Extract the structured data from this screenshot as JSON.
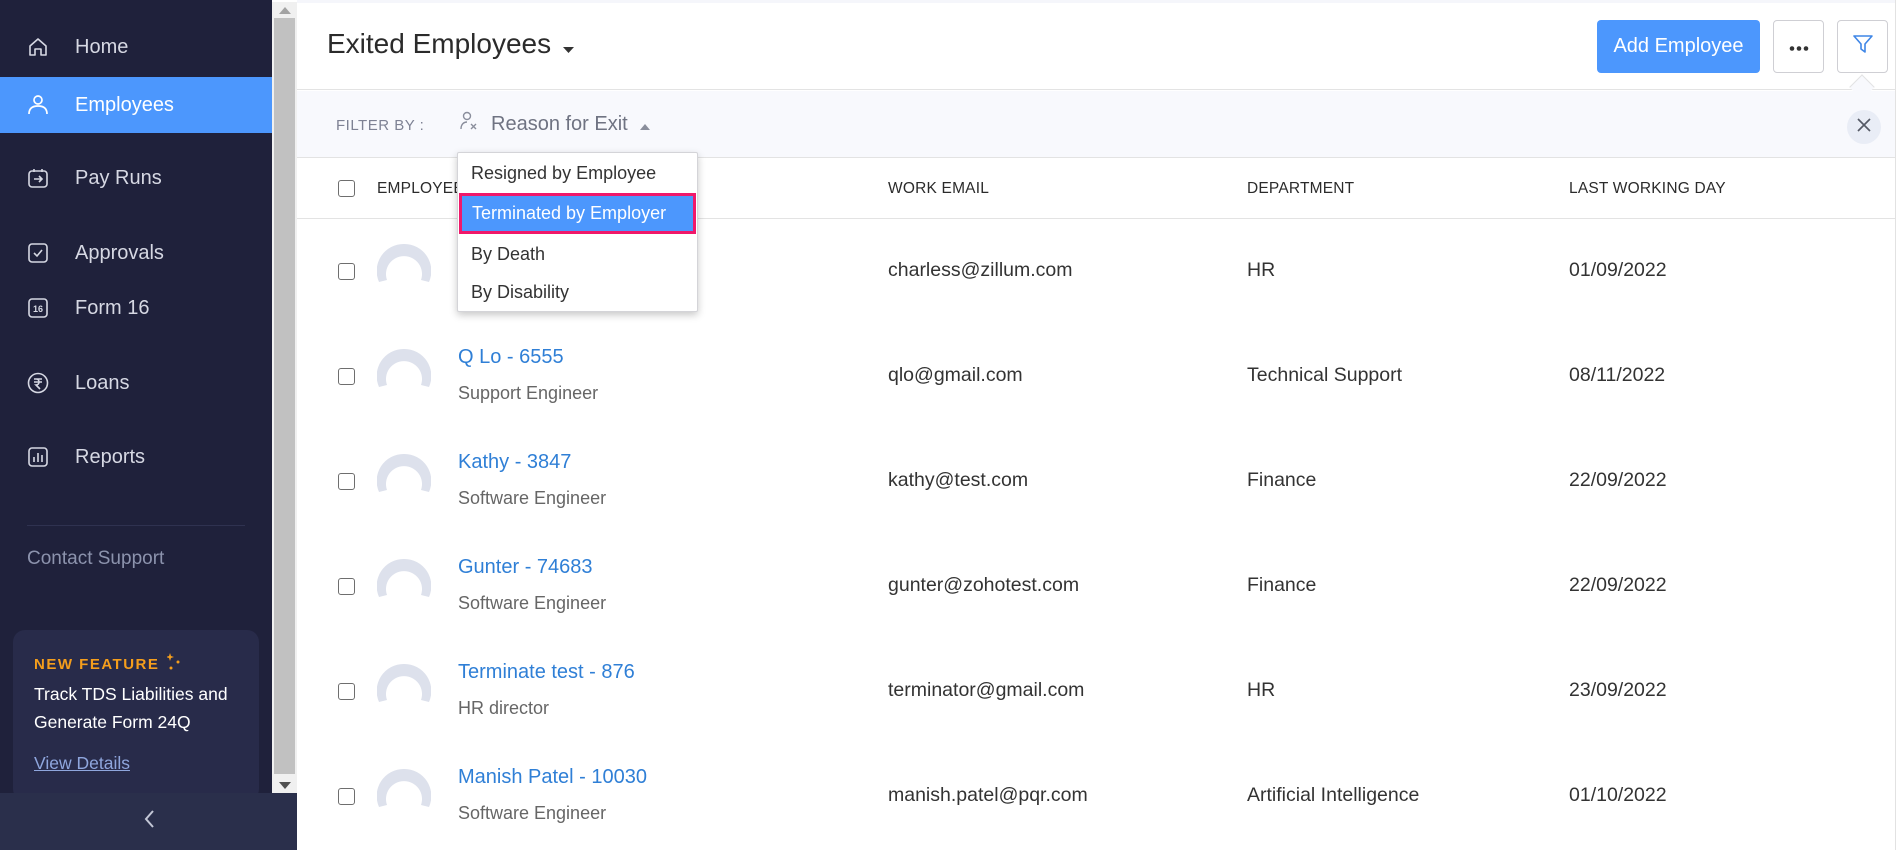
{
  "sidebar": {
    "items": [
      {
        "label": "Home",
        "icon": "home-icon",
        "active": false
      },
      {
        "label": "Employees",
        "icon": "user-icon",
        "active": true
      },
      {
        "label": "Pay Runs",
        "icon": "payrun-calendar-icon",
        "active": false
      },
      {
        "label": "Approvals",
        "icon": "approval-check-icon",
        "active": false
      },
      {
        "label": "Form 16",
        "icon": "form16-icon",
        "active": false
      },
      {
        "label": "Loans",
        "icon": "rupee-icon",
        "active": false
      },
      {
        "label": "Reports",
        "icon": "bar-chart-icon",
        "active": false
      }
    ],
    "contact_support": "Contact Support",
    "feature_card": {
      "tag": "NEW FEATURE",
      "text": "Track TDS Liabilities and Generate Form 24Q",
      "link": "View Details"
    },
    "collapse_icon": "chevron-left-icon"
  },
  "header": {
    "title": "Exited Employees",
    "add_button": "Add Employee",
    "more_icon": "more-horizontal-icon",
    "filter_icon": "filter-icon"
  },
  "filter_bar": {
    "label": "FILTER BY :",
    "select_label": "Reason for Exit",
    "select_icon": "user-remove-icon"
  },
  "dropdown": {
    "options": [
      {
        "label": "Resigned by Employee",
        "selected": false
      },
      {
        "label": "Terminated by Employer",
        "selected": true
      },
      {
        "label": "By Death",
        "selected": false
      },
      {
        "label": "By Disability",
        "selected": false
      }
    ]
  },
  "table": {
    "columns": [
      "EMPLOYEE NAME",
      "WORK EMAIL",
      "DEPARTMENT",
      "LAST WORKING DAY"
    ],
    "visible_header_fragment": "EMPLOYEE",
    "rows": [
      {
        "name": "",
        "role": "",
        "email": "charless@zillum.com",
        "department": "HR",
        "last_day": "01/09/2022"
      },
      {
        "name": "Q Lo - 6555",
        "role": "Support Engineer",
        "email": "qlo@gmail.com",
        "department": "Technical Support",
        "last_day": "08/11/2022"
      },
      {
        "name": "Kathy - 3847",
        "role": "Software Engineer",
        "email": "kathy@test.com",
        "department": "Finance",
        "last_day": "22/09/2022"
      },
      {
        "name": "Gunter - 74683",
        "role": "Software Engineer",
        "email": "gunter@zohotest.com",
        "department": "Finance",
        "last_day": "22/09/2022"
      },
      {
        "name": "Terminate test - 876",
        "role": "HR director",
        "email": "terminator@gmail.com",
        "department": "HR",
        "last_day": "23/09/2022"
      },
      {
        "name": "Manish Patel - 10030",
        "role": "Software Engineer",
        "email": "manish.patel@pqr.com",
        "department": "Artificial Intelligence",
        "last_day": "01/10/2022"
      }
    ]
  },
  "colors": {
    "sidebar_bg": "#1f213b",
    "accent": "#4c97fd",
    "link": "#2f7fd6",
    "feature_tag": "#f59e1c",
    "selection_border": "#f0186a"
  }
}
